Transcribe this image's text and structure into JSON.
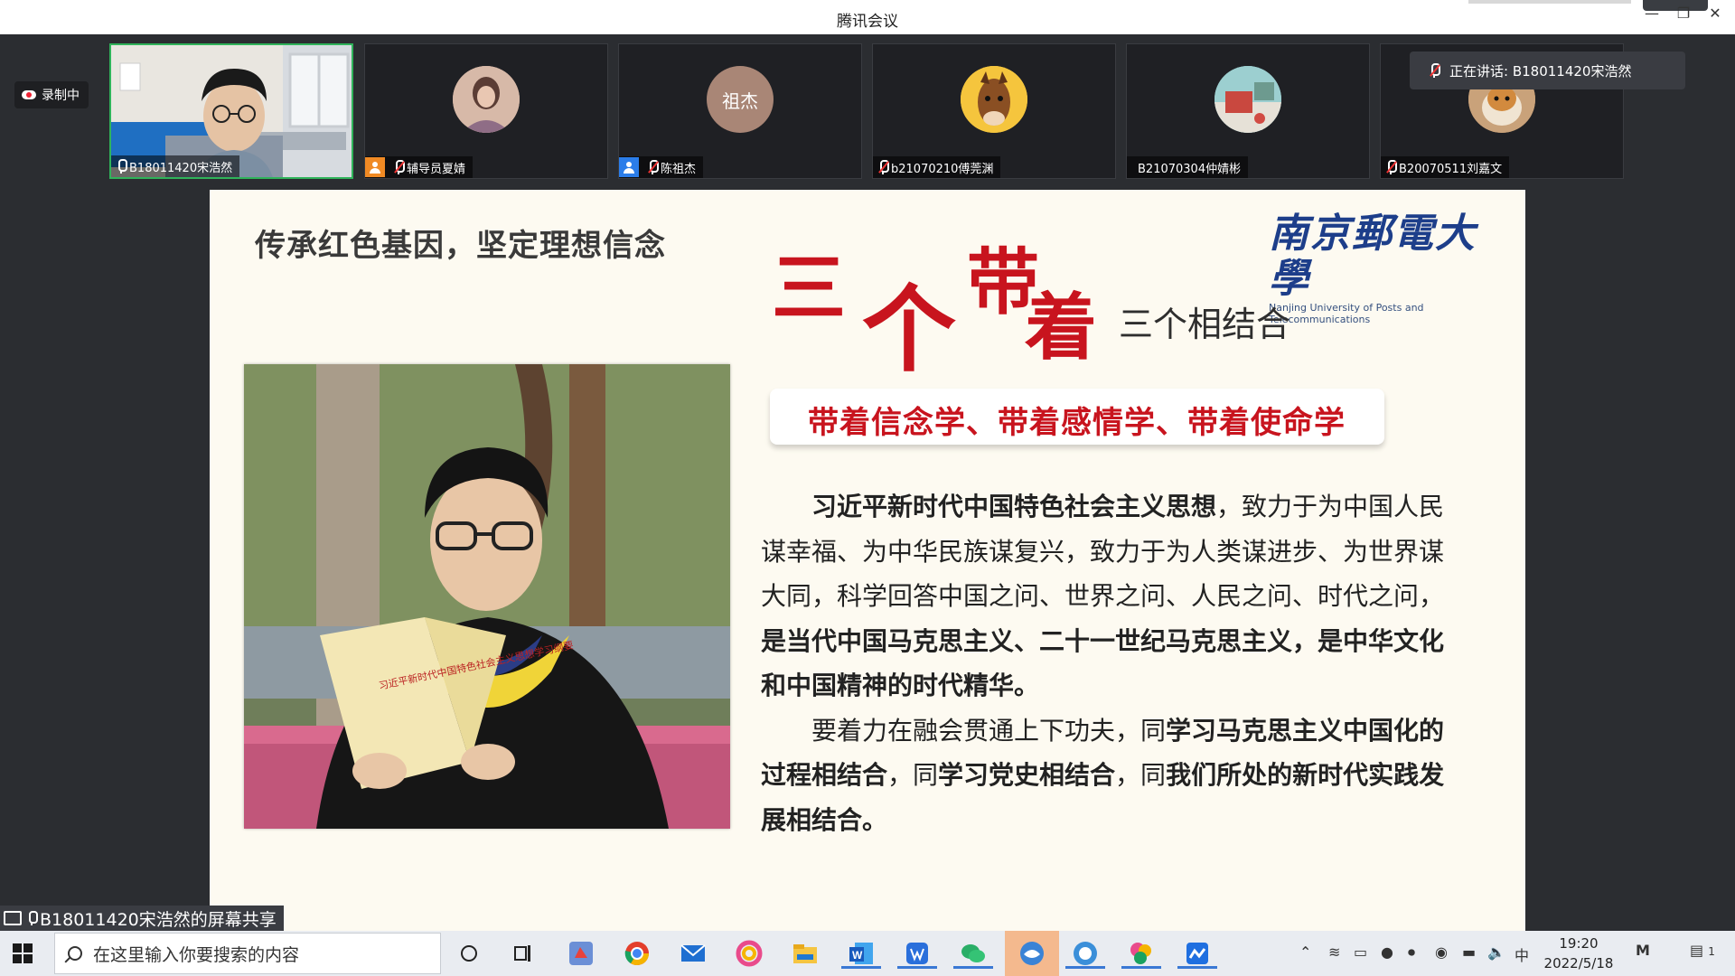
{
  "window": {
    "title": "腾讯会议"
  },
  "meeting": {
    "recording_label": "录制中",
    "speaking_label": "正在讲话: B18011420宋浩然",
    "participants": [
      {
        "name": "B18011420宋浩然",
        "muted": false,
        "badge": ""
      },
      {
        "name": "辅导员夏婧",
        "muted": true,
        "badge": "orange"
      },
      {
        "name": "陈祖杰",
        "muted": true,
        "badge": "blue",
        "avatar_text": "祖杰"
      },
      {
        "name": "b21070210傅莞渊",
        "muted": true,
        "badge": ""
      },
      {
        "name": "B21070304仲婧彬",
        "muted": false,
        "badge": ""
      },
      {
        "name": "B20070511刘嘉文",
        "muted": true,
        "badge": ""
      }
    ],
    "share_label": "B18011420宋浩然的屏幕共享"
  },
  "slide": {
    "heading": "传承红色基因，坚定理想信念",
    "logo_cn": "南京郵電大學",
    "logo_en": "Nanjing University of Posts and Telecommunications",
    "callig": [
      "三",
      "个",
      "带",
      "着"
    ],
    "subtitle": "三个相结合",
    "ribbon": "带着信念学、带着感情学、带着使命学",
    "para1_bold_a": "习近平新时代中国特色社会主义思想",
    "para1_text_a": "，致力于为中国人民谋幸福、为中华民族谋复兴，致力于为人类谋进步、为世界谋大同，科学回答中国之问、世界之问、人民之问、时代之问，",
    "para1_bold_b": "是当代中国马克思主义、二十一世纪马克思主义，是中华文化和中国精神的时代精华。",
    "para2_text_a": "要着力在融会贯通上下功夫，同",
    "para2_bold_a": "学习马克思主义中国化的过程相结合",
    "para2_text_b": "，同",
    "para2_bold_b": "学习党史相结合",
    "para2_text_c": "，同",
    "para2_bold_c": "我们所处的新时代实践发展相结合。",
    "book_title": "习近平新时代中国特色社会主义思想学习纲要"
  },
  "taskbar": {
    "search_placeholder": "在这里输入你要搜索的内容",
    "ime": "中",
    "time": "19:20",
    "date": "2022/5/18",
    "notification_count": "1",
    "apps": [
      "tencent-meeting",
      "chrome",
      "mail",
      "photos",
      "file-explorer",
      "word",
      "wps",
      "wechat",
      "meeting-active",
      "edge-browser",
      "paint",
      "feishu"
    ]
  },
  "colors": {
    "accent_red": "#c8141e",
    "active_border": "#2fb35a",
    "logo_blue": "#1d3e8a"
  }
}
